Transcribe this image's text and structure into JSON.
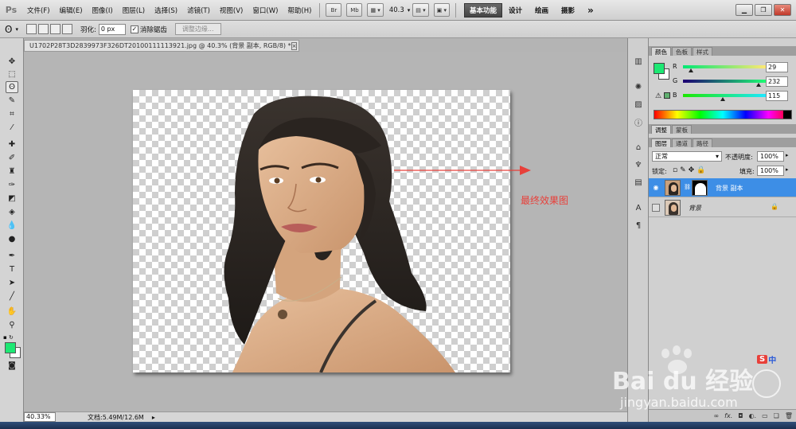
{
  "app": {
    "logo": "Ps"
  },
  "menu": [
    "文件(F)",
    "编辑(E)",
    "图像(I)",
    "图层(L)",
    "选择(S)",
    "滤镜(T)",
    "视图(V)",
    "窗口(W)",
    "帮助(H)"
  ],
  "menubar": {
    "btn_bridge": "Br",
    "btn_minibridge": "Mb",
    "zoom": "40.3"
  },
  "workspace": {
    "active": "基本功能",
    "items": [
      "设计",
      "绘画",
      "摄影"
    ],
    "more": "»"
  },
  "options": {
    "feather_label": "羽化:",
    "feather_value": "0 px",
    "antialias_label": "消除锯齿",
    "antialias_check": "✓",
    "refine_edge": "调整边缘..."
  },
  "document": {
    "tab_title": "U1702P28T3D2839973F326DT20100111113921.jpg @ 40.3% (背景 副本, RGB/8) *",
    "tab_close": "×",
    "annotation": "最终效果图"
  },
  "status": {
    "zoom": "40.33%",
    "doc_size": "文档:5.49M/12.6M"
  },
  "color_panel": {
    "tabs": [
      "颜色",
      "色板",
      "样式"
    ],
    "r_label": "R",
    "g_label": "G",
    "b_label": "B",
    "r": 29,
    "g": 232,
    "b": 115,
    "fg_color": "#1de873",
    "warn_icon": "⚠"
  },
  "adjust_tabs": [
    "调整",
    "蒙板"
  ],
  "layers_panel": {
    "tabs": [
      "图层",
      "通道",
      "路径"
    ],
    "blend_mode": "正常",
    "opacity_label": "不透明度:",
    "opacity": "100%",
    "lock_label": "锁定:",
    "fill_label": "填充:",
    "fill": "100%",
    "layers": [
      {
        "name": "背景 副本",
        "selected": true
      },
      {
        "name": "背景",
        "selected": false
      }
    ],
    "footer_icons": [
      "link-icon",
      "fx-icon",
      "mask-icon",
      "adjustment-icon",
      "group-icon",
      "new-layer-icon",
      "trash-icon"
    ]
  },
  "watermark": {
    "brand": "Bai du 经验",
    "url": "jingyan.baidu.com",
    "badge": "中",
    "badge_s": "S"
  }
}
